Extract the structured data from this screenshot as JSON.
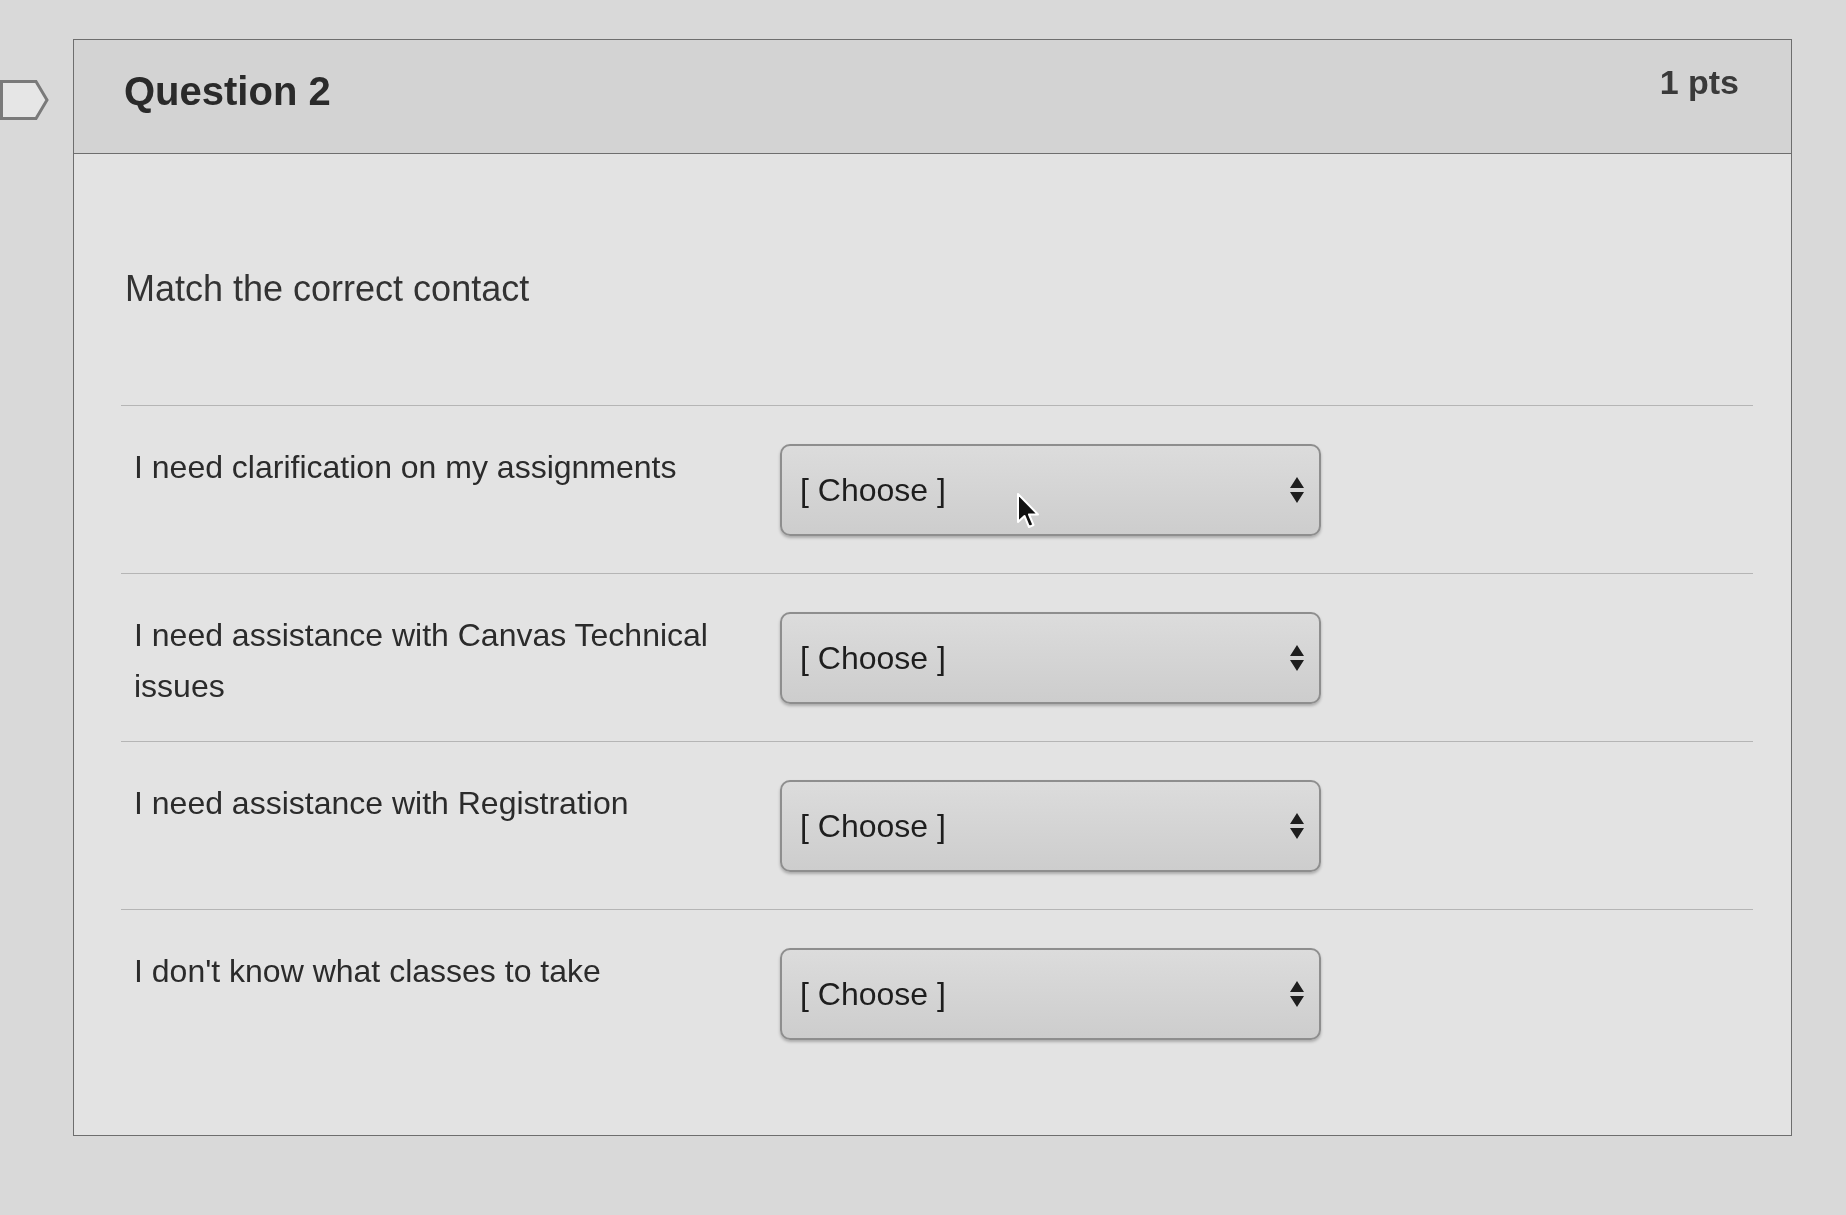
{
  "question": {
    "title": "Question 2",
    "points": "1 pts"
  },
  "prompt": "Match the correct contact",
  "matches": [
    {
      "label": "I need clarification on my assignments",
      "dropdown": "[ Choose ]"
    },
    {
      "label": "I need assistance with Canvas Technical issues",
      "dropdown": "[ Choose ]"
    },
    {
      "label": "I need assistance with Registration",
      "dropdown": "[ Choose ]"
    },
    {
      "label": "I don't know what classes to take",
      "dropdown": "[ Choose ]"
    }
  ]
}
